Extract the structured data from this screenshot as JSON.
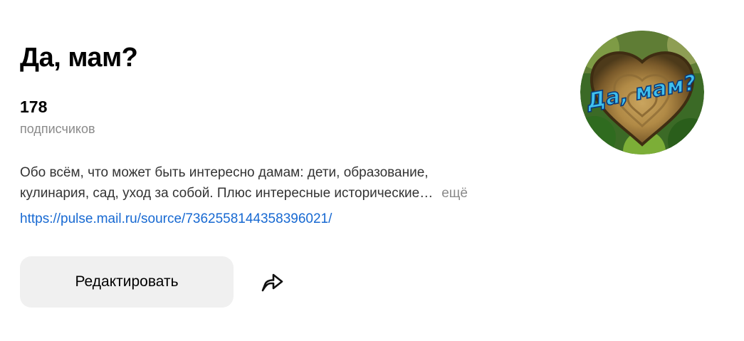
{
  "channel": {
    "title": "Да, мам?",
    "subscribers_count": "178",
    "subscribers_label": "подписчиков",
    "description_line1": "Обо всём, что может быть интересно дамам: дети, образование,",
    "description_line2": "кулинария, сад, уход за собой. Плюс интересные исторические…",
    "more_label": "ещё",
    "link": "https://pulse.mail.ru/source/7362558144358396021/",
    "avatar_text": "Да, мам?"
  },
  "actions": {
    "edit_label": "Редактировать",
    "share_icon": "share-arrow-icon"
  },
  "colors": {
    "link": "#1769d2",
    "muted_text": "#8a8a8a",
    "button_bg": "#f0f0f0",
    "avatar_text": "#3fc0ee"
  }
}
